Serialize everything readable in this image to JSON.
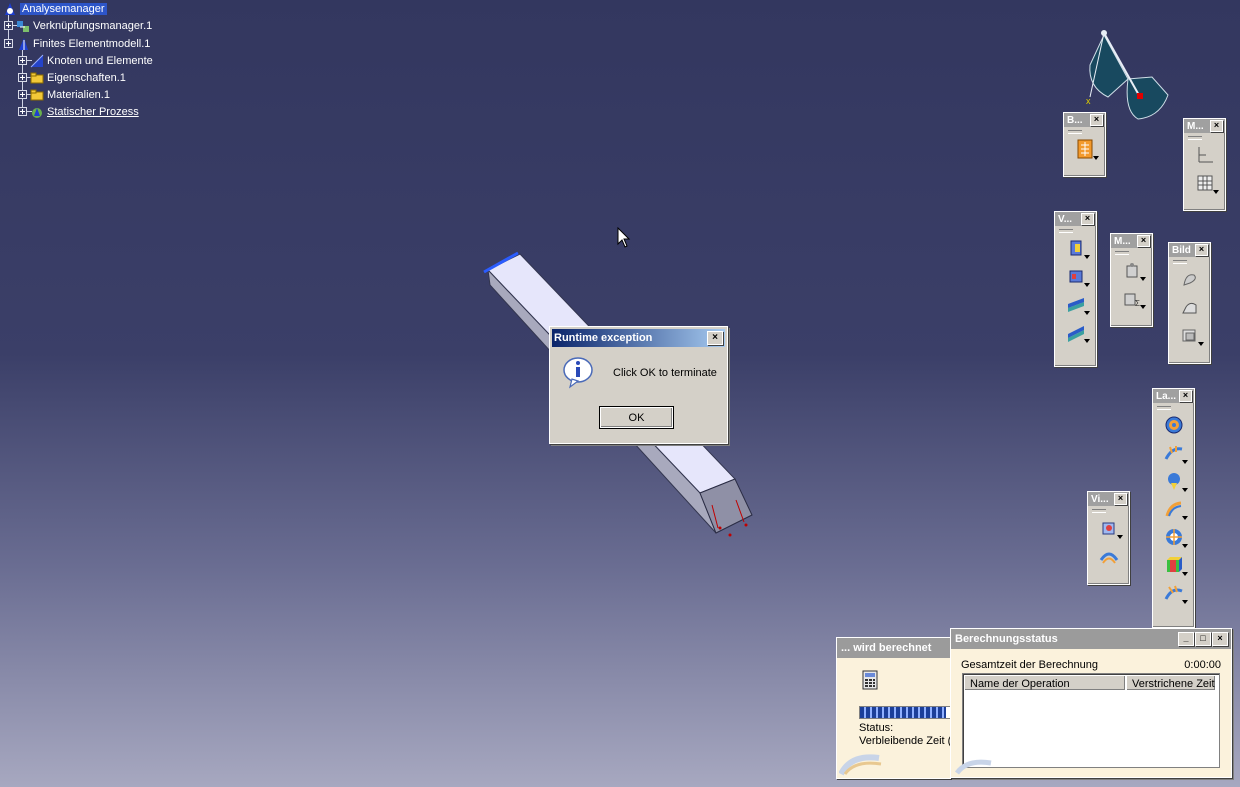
{
  "tree": {
    "items": [
      {
        "label": "Analysemanager",
        "icon": "analysis-manager-icon",
        "selected": true
      },
      {
        "label": "Verknüpfungsmanager.1",
        "icon": "links-manager-icon"
      },
      {
        "label": "Finites Elementmodell.1",
        "icon": "fem-model-icon"
      },
      {
        "label": "Knoten und Elemente",
        "icon": "nodes-elements-icon"
      },
      {
        "label": "Eigenschaften.1",
        "icon": "folder-icon"
      },
      {
        "label": "Materialien.1",
        "icon": "folder-icon"
      },
      {
        "label": "Statischer Prozess",
        "icon": "static-process-icon",
        "underlined": true
      }
    ]
  },
  "toolbars": {
    "b": {
      "title": "B..."
    },
    "m1": {
      "title": "M..."
    },
    "v": {
      "title": "V..."
    },
    "m2": {
      "title": "M..."
    },
    "bild": {
      "title": "Bild"
    },
    "la": {
      "title": "La..."
    },
    "vi": {
      "title": "Vi..."
    }
  },
  "dialog": {
    "title": "Runtime exception",
    "message": "Click OK to terminate",
    "ok_label": "OK",
    "close_glyph": "×",
    "icon": "info-icon"
  },
  "calc_window": {
    "title": "... wird berechnet",
    "status_label": "Status:",
    "remaining_label": "Verbleibende Zeit (",
    "progress": 0.95
  },
  "status_window": {
    "title": "Berechnungsstatus",
    "total_label": "Gesamtzeit der Berechnung",
    "total_value": "0:00:00",
    "columns": [
      "Name der Operation",
      "Verstrichene Zeit"
    ],
    "buttons": [
      "_",
      "□",
      "×"
    ]
  },
  "colors": {
    "viewport_top": "#33375f",
    "viewport_bottom": "#a7a8c0",
    "selection": "#2d55c8",
    "dialog_title": "#0a246a"
  }
}
